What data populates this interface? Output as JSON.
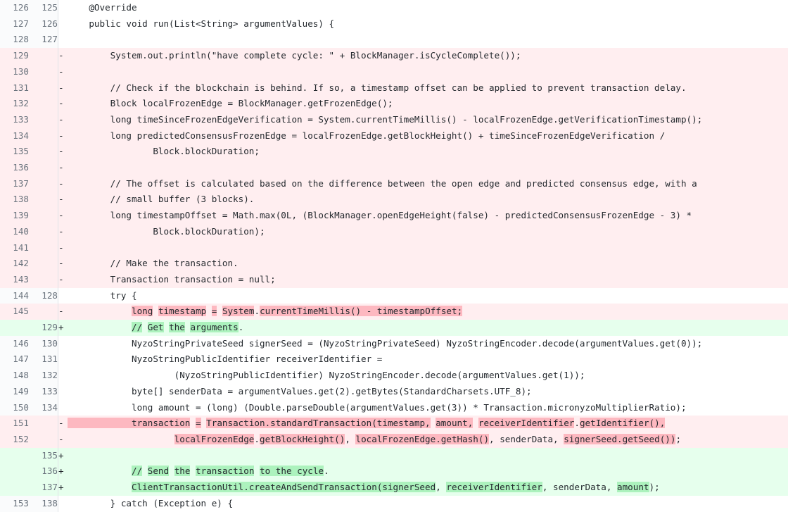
{
  "view": {
    "kind": "unified-code-diff",
    "language": "java",
    "colors": {
      "deletion_line_bg": "#ffeef0",
      "deletion_word_bg": "#fdb8c0",
      "addition_line_bg": "#e6ffed",
      "addition_word_bg": "#acf2bd",
      "gutter_bg": "#fafbfc",
      "gutter_border": "#e1e4e8",
      "text": "#24292e",
      "line_number_text": "#6a737d"
    },
    "markers": {
      "deletion": "-",
      "addition": "+",
      "context": ""
    }
  },
  "rows": [
    {
      "old": "126",
      "new": "125",
      "marker": "",
      "type": "ctx",
      "clipped": true,
      "segments": [
        {
          "t": "    @Override",
          "h": false
        }
      ]
    },
    {
      "old": "127",
      "new": "126",
      "marker": "",
      "type": "ctx",
      "segments": [
        {
          "t": "    public void run(List<String> argumentValues) {",
          "h": false
        }
      ]
    },
    {
      "old": "128",
      "new": "127",
      "marker": "",
      "type": "ctx",
      "segments": [
        {
          "t": "",
          "h": false
        }
      ]
    },
    {
      "old": "129",
      "new": "",
      "marker": "-",
      "type": "del",
      "segments": [
        {
          "t": "        System.out.println(\"have complete cycle: \" + BlockManager.isCycleComplete());",
          "h": false
        }
      ]
    },
    {
      "old": "130",
      "new": "",
      "marker": "-",
      "type": "del",
      "segments": [
        {
          "t": "",
          "h": false
        }
      ]
    },
    {
      "old": "131",
      "new": "",
      "marker": "-",
      "type": "del",
      "segments": [
        {
          "t": "        // Check if the blockchain is behind. If so, a timestamp offset can be applied to prevent transaction delay.",
          "h": false
        }
      ]
    },
    {
      "old": "132",
      "new": "",
      "marker": "-",
      "type": "del",
      "segments": [
        {
          "t": "        Block localFrozenEdge = BlockManager.getFrozenEdge();",
          "h": false
        }
      ]
    },
    {
      "old": "133",
      "new": "",
      "marker": "-",
      "type": "del",
      "segments": [
        {
          "t": "        long timeSinceFrozenEdgeVerification = System.currentTimeMillis() - localFrozenEdge.getVerificationTimestamp();",
          "h": false
        }
      ]
    },
    {
      "old": "134",
      "new": "",
      "marker": "-",
      "type": "del",
      "segments": [
        {
          "t": "        long predictedConsensusFrozenEdge = localFrozenEdge.getBlockHeight() + timeSinceFrozenEdgeVerification /",
          "h": false
        }
      ]
    },
    {
      "old": "135",
      "new": "",
      "marker": "-",
      "type": "del",
      "segments": [
        {
          "t": "                Block.blockDuration;",
          "h": false
        }
      ]
    },
    {
      "old": "136",
      "new": "",
      "marker": "-",
      "type": "del",
      "segments": [
        {
          "t": "",
          "h": false
        }
      ]
    },
    {
      "old": "137",
      "new": "",
      "marker": "-",
      "type": "del",
      "segments": [
        {
          "t": "        // The offset is calculated based on the difference between the open edge and predicted consensus edge, with a",
          "h": false
        }
      ]
    },
    {
      "old": "138",
      "new": "",
      "marker": "-",
      "type": "del",
      "segments": [
        {
          "t": "        // small buffer (3 blocks).",
          "h": false
        }
      ]
    },
    {
      "old": "139",
      "new": "",
      "marker": "-",
      "type": "del",
      "segments": [
        {
          "t": "        long timestampOffset = Math.max(0L, (BlockManager.openEdgeHeight(false) - predictedConsensusFrozenEdge - 3) *",
          "h": false
        }
      ]
    },
    {
      "old": "140",
      "new": "",
      "marker": "-",
      "type": "del",
      "segments": [
        {
          "t": "                Block.blockDuration);",
          "h": false
        }
      ]
    },
    {
      "old": "141",
      "new": "",
      "marker": "-",
      "type": "del",
      "segments": [
        {
          "t": "",
          "h": false
        }
      ]
    },
    {
      "old": "142",
      "new": "",
      "marker": "-",
      "type": "del",
      "segments": [
        {
          "t": "        // Make the transaction.",
          "h": false
        }
      ]
    },
    {
      "old": "143",
      "new": "",
      "marker": "-",
      "type": "del",
      "segments": [
        {
          "t": "        Transaction transaction = null;",
          "h": false
        }
      ]
    },
    {
      "old": "144",
      "new": "128",
      "marker": "",
      "type": "ctx",
      "segments": [
        {
          "t": "        try {",
          "h": false
        }
      ]
    },
    {
      "old": "145",
      "new": "",
      "marker": "-",
      "type": "del",
      "segments": [
        {
          "t": "            ",
          "h": false
        },
        {
          "t": "long",
          "h": true
        },
        {
          "t": " ",
          "h": false
        },
        {
          "t": "timestamp",
          "h": true
        },
        {
          "t": " ",
          "h": false
        },
        {
          "t": "=",
          "h": true
        },
        {
          "t": " ",
          "h": false
        },
        {
          "t": "System",
          "h": true
        },
        {
          "t": ".",
          "h": false
        },
        {
          "t": "currentTimeMillis() - timestampOffset;",
          "h": true
        }
      ]
    },
    {
      "old": "",
      "new": "129",
      "marker": "+",
      "type": "add",
      "segments": [
        {
          "t": "            ",
          "h": false
        },
        {
          "t": "//",
          "h": true
        },
        {
          "t": " ",
          "h": false
        },
        {
          "t": "Get",
          "h": true
        },
        {
          "t": " ",
          "h": false
        },
        {
          "t": "the",
          "h": true
        },
        {
          "t": " ",
          "h": false
        },
        {
          "t": "arguments",
          "h": true
        },
        {
          "t": ".",
          "h": false
        }
      ]
    },
    {
      "old": "146",
      "new": "130",
      "marker": "",
      "type": "ctx",
      "segments": [
        {
          "t": "            NyzoStringPrivateSeed signerSeed = (NyzoStringPrivateSeed) NyzoStringEncoder.decode(argumentValues.get(0));",
          "h": false
        }
      ]
    },
    {
      "old": "147",
      "new": "131",
      "marker": "",
      "type": "ctx",
      "segments": [
        {
          "t": "            NyzoStringPublicIdentifier receiverIdentifier =",
          "h": false
        }
      ]
    },
    {
      "old": "148",
      "new": "132",
      "marker": "",
      "type": "ctx",
      "segments": [
        {
          "t": "                    (NyzoStringPublicIdentifier) NyzoStringEncoder.decode(argumentValues.get(1));",
          "h": false
        }
      ]
    },
    {
      "old": "149",
      "new": "133",
      "marker": "",
      "type": "ctx",
      "segments": [
        {
          "t": "            byte[] senderData = argumentValues.get(2).getBytes(StandardCharsets.UTF_8);",
          "h": false
        }
      ]
    },
    {
      "old": "150",
      "new": "134",
      "marker": "",
      "type": "ctx",
      "segments": [
        {
          "t": "            long amount = (long) (Double.parseDouble(argumentValues.get(3)) * Transaction.micronyzoMultiplierRatio);",
          "h": false
        }
      ]
    },
    {
      "old": "151",
      "new": "",
      "marker": "-",
      "type": "del",
      "segments": [
        {
          "t": "            transaction",
          "h": true
        },
        {
          "t": " ",
          "h": false
        },
        {
          "t": "=",
          "h": true
        },
        {
          "t": " ",
          "h": false
        },
        {
          "t": "Transaction.standardTransaction(timestamp,",
          "h": true
        },
        {
          "t": " ",
          "h": false
        },
        {
          "t": "amount,",
          "h": true
        },
        {
          "t": " ",
          "h": false
        },
        {
          "t": "receiverIdentifier",
          "h": true
        },
        {
          "t": ".",
          "h": false
        },
        {
          "t": "getIdentifier(),",
          "h": true
        }
      ]
    },
    {
      "old": "152",
      "new": "",
      "marker": "-",
      "type": "del",
      "segments": [
        {
          "t": "                    ",
          "h": false
        },
        {
          "t": "localFrozenEdge",
          "h": true
        },
        {
          "t": ".",
          "h": false
        },
        {
          "t": "getBlockHeight()",
          "h": true
        },
        {
          "t": ", ",
          "h": false
        },
        {
          "t": "localFrozenEdge.getHash()",
          "h": true
        },
        {
          "t": ", ",
          "h": false
        },
        {
          "t": "senderData",
          "h": false
        },
        {
          "t": ", ",
          "h": false
        },
        {
          "t": "signerSeed.getSeed())",
          "h": true
        },
        {
          "t": ";",
          "h": false
        }
      ]
    },
    {
      "old": "",
      "new": "135",
      "marker": "+",
      "type": "add",
      "segments": [
        {
          "t": "",
          "h": false
        }
      ]
    },
    {
      "old": "",
      "new": "136",
      "marker": "+",
      "type": "add",
      "segments": [
        {
          "t": "            ",
          "h": false
        },
        {
          "t": "//",
          "h": true
        },
        {
          "t": " ",
          "h": false
        },
        {
          "t": "Send",
          "h": true
        },
        {
          "t": " ",
          "h": false
        },
        {
          "t": "the",
          "h": true
        },
        {
          "t": " ",
          "h": false
        },
        {
          "t": "transaction",
          "h": true
        },
        {
          "t": " ",
          "h": false
        },
        {
          "t": "to the cycle",
          "h": true
        },
        {
          "t": ".",
          "h": false
        }
      ]
    },
    {
      "old": "",
      "new": "137",
      "marker": "+",
      "type": "add",
      "segments": [
        {
          "t": "            ",
          "h": false
        },
        {
          "t": "ClientTransactionUtil.createAndSendTransaction(",
          "h": true
        },
        {
          "t": "signerSeed",
          "h": true
        },
        {
          "t": ", ",
          "h": false
        },
        {
          "t": "receiverIdentifier",
          "h": true
        },
        {
          "t": ", senderData, ",
          "h": false
        },
        {
          "t": "amount",
          "h": true
        },
        {
          "t": ");",
          "h": false
        }
      ]
    },
    {
      "old": "153",
      "new": "138",
      "marker": "",
      "type": "ctx",
      "segments": [
        {
          "t": "        } catch (Exception e) {",
          "h": false
        }
      ]
    }
  ]
}
